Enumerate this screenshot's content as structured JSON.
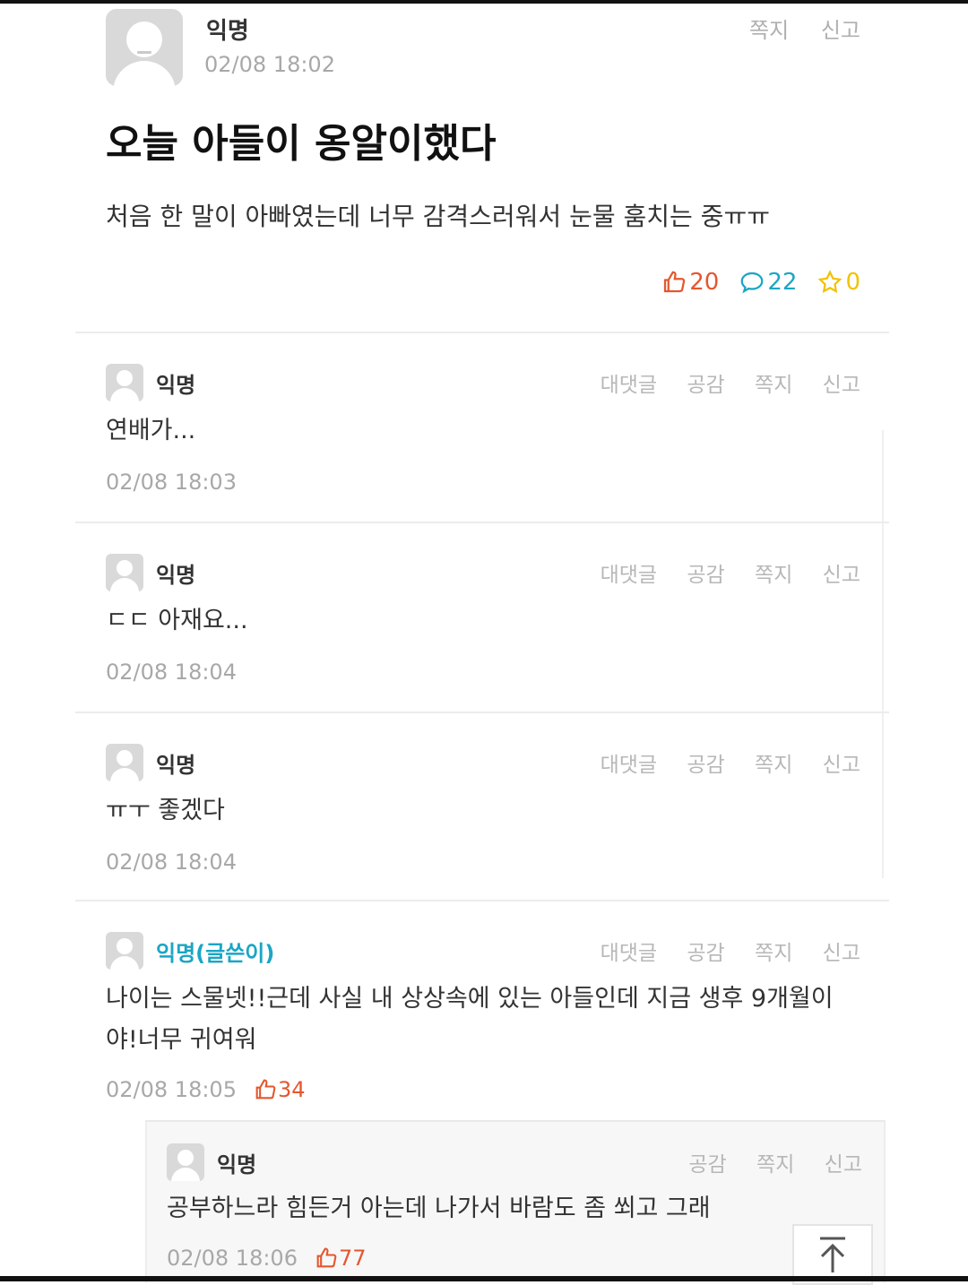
{
  "post": {
    "author": "익명",
    "time": "02/08 18:02",
    "actions": [
      "쪽지",
      "신고"
    ],
    "title": "오늘 아들이 옹알이했다",
    "body": "처음 한 말이 아빠였는데 너무 감격스러워서 눈물 훔치는 중ㅠㅠ",
    "likes": "20",
    "comments": "22",
    "scraps": "0"
  },
  "comments": [
    {
      "author": "익명",
      "text": "연배가...",
      "time": "02/08 18:03",
      "actions": [
        "대댓글",
        "공감",
        "쪽지",
        "신고"
      ]
    },
    {
      "author": "익명",
      "text": "ㄷㄷ 아재요...",
      "time": "02/08 18:04",
      "actions": [
        "대댓글",
        "공감",
        "쪽지",
        "신고"
      ]
    },
    {
      "author": "익명",
      "text": "ㅠㅜ 좋겠다",
      "time": "02/08 18:04",
      "actions": [
        "대댓글",
        "공감",
        "쪽지",
        "신고"
      ]
    },
    {
      "author": "익명(글쓴이)",
      "text": "나이는 스물넷!!근데 사실 내 상상속에 있는 아들인데 지금 생후 9개월이야!너무 귀여워",
      "time": "02/08 18:05",
      "likes": "34",
      "actions": [
        "대댓글",
        "공감",
        "쪽지",
        "신고"
      ]
    }
  ],
  "reply": {
    "author": "익명",
    "text": "공부하느라 힘든거 아는데 나가서 바람도 좀 쐬고 그래",
    "time": "02/08 18:06",
    "likes": "77",
    "actions": [
      "공감",
      "쪽지",
      "신고"
    ]
  },
  "icons": {
    "like": "thumbs-up-icon",
    "comment": "speech-bubble-icon",
    "scrap": "star-icon",
    "top": "scroll-top-icon"
  },
  "colors": {
    "like": "#e4572e",
    "comment": "#1aa6c4",
    "scrap": "#f2c200",
    "op_author": "#1aa6c4"
  }
}
